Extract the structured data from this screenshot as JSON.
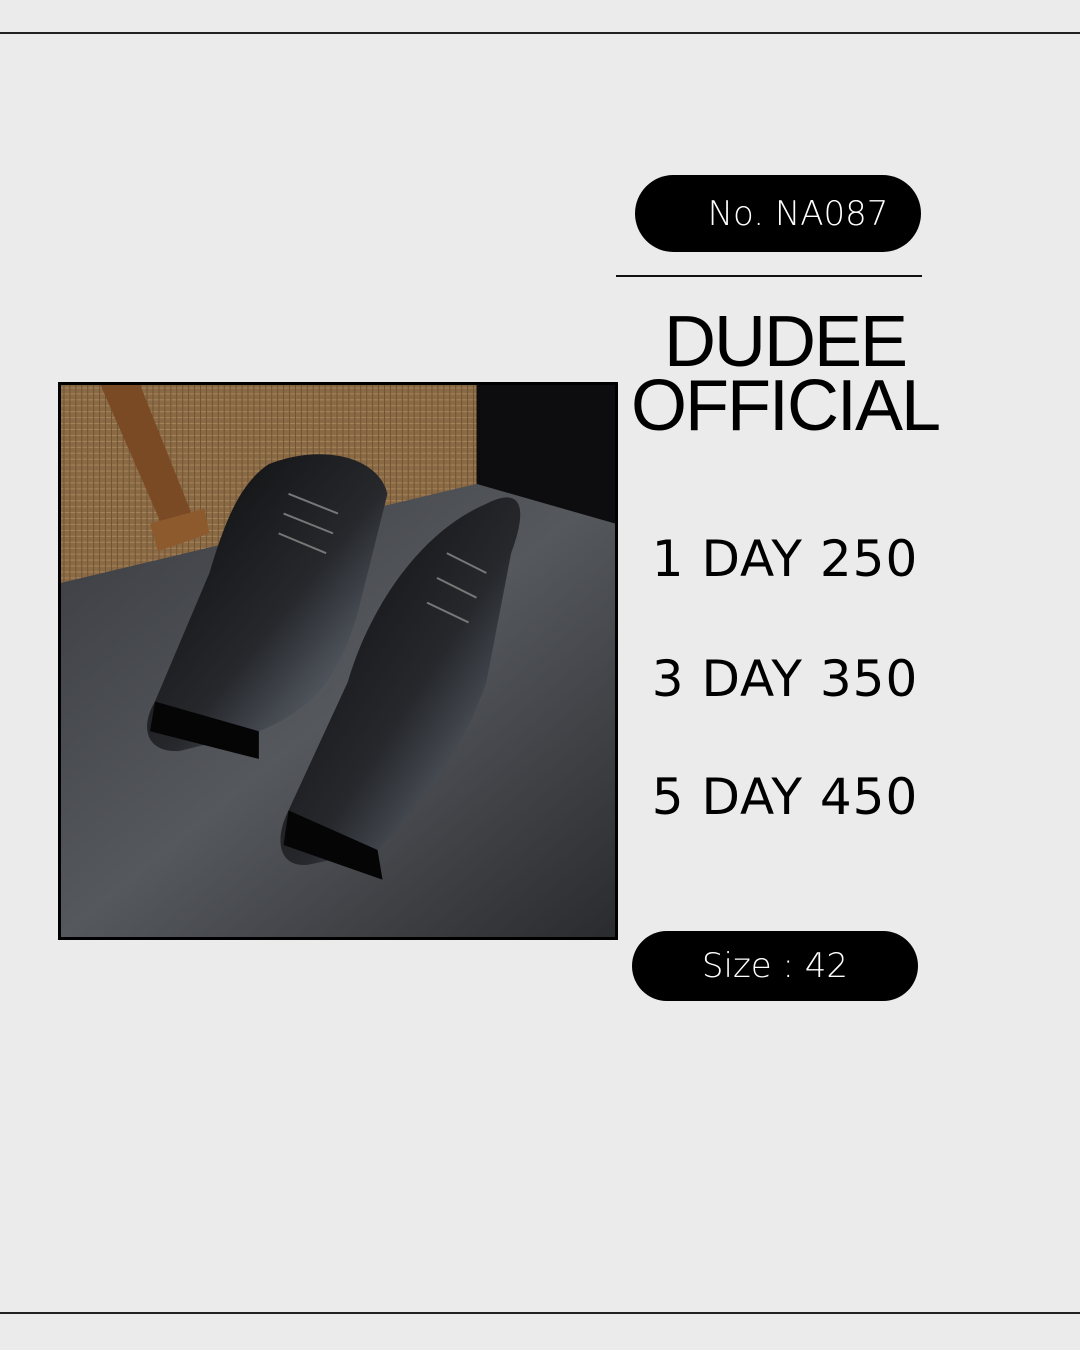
{
  "product": {
    "code": "No. NA087",
    "brand_line1": "DUDEE",
    "brand_line2": "OFFICIAL",
    "size": "Size : 42"
  },
  "pricing": [
    {
      "label": "1 DAY 250"
    },
    {
      "label": "3 DAY 350"
    },
    {
      "label": "5 DAY 450"
    }
  ],
  "photo": {
    "icon": "shoe-photo",
    "subject": "black leather derby shoes"
  },
  "colors": {
    "background": "#ebebeb",
    "pill": "#000000",
    "text": "#000000"
  }
}
